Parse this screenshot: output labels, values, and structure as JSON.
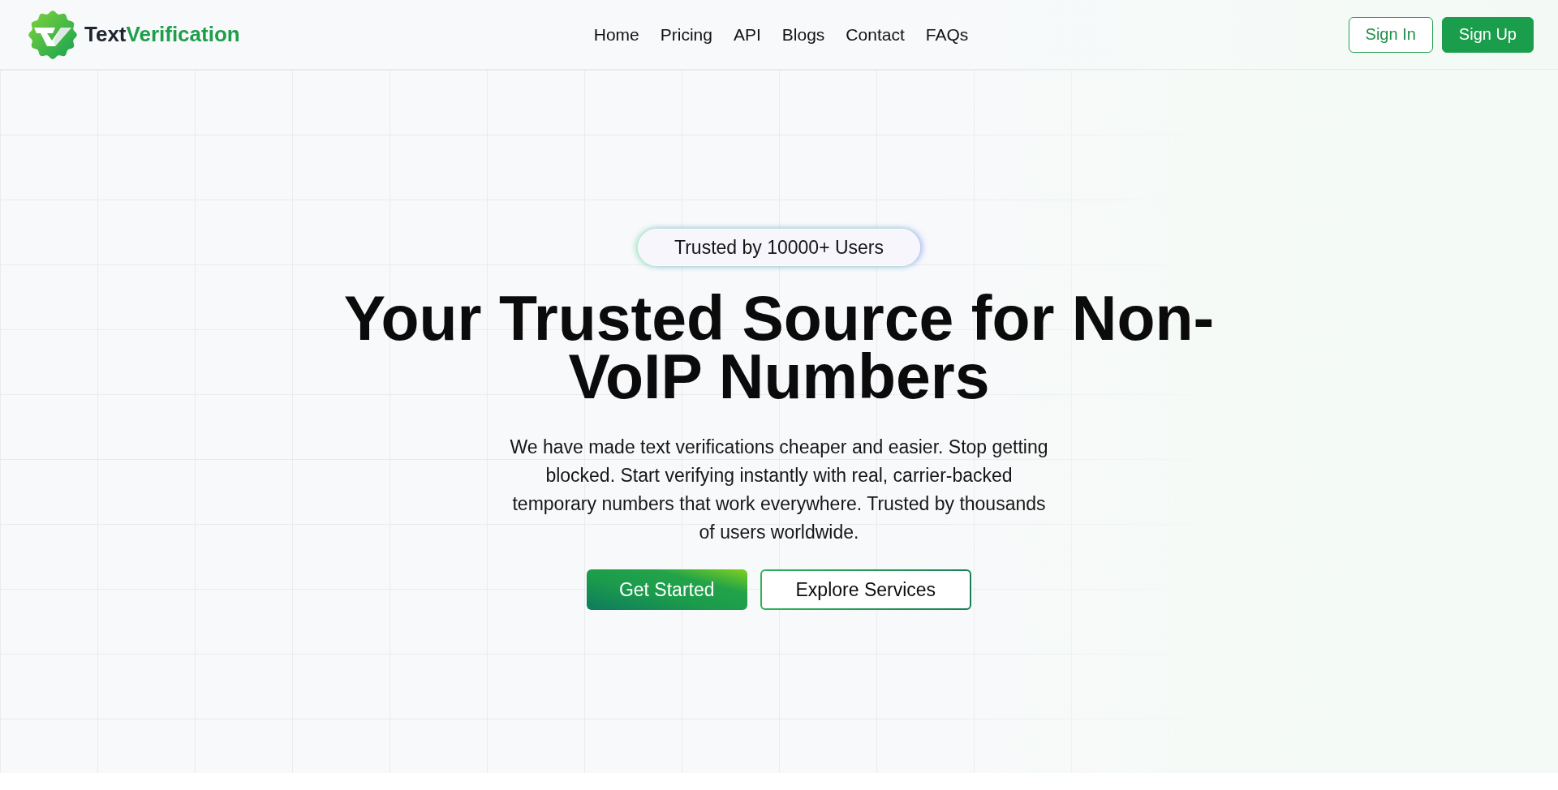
{
  "header": {
    "brand": {
      "dark": "Text",
      "accent": "Verification"
    },
    "nav": [
      {
        "label": "Home"
      },
      {
        "label": "Pricing"
      },
      {
        "label": "API"
      },
      {
        "label": "Blogs"
      },
      {
        "label": "Contact"
      },
      {
        "label": "FAQs"
      }
    ],
    "actions": [
      {
        "label": "Sign In",
        "kind": "outline"
      },
      {
        "label": "Sign Up",
        "kind": "filled"
      }
    ]
  },
  "hero": {
    "badge": "Trusted by 10000+ Users",
    "title": "Your Trusted Source for Non-VoIP Numbers",
    "description": "We have made text verifications cheaper and easier. Stop getting blocked. Start verifying instantly with real, carrier-backed temporary numbers that work everywhere. Trusted by thousands of users worldwide.",
    "buttons": [
      {
        "label": "Get Started",
        "kind": "primary"
      },
      {
        "label": "Explore Services",
        "kind": "secondary"
      }
    ]
  }
}
